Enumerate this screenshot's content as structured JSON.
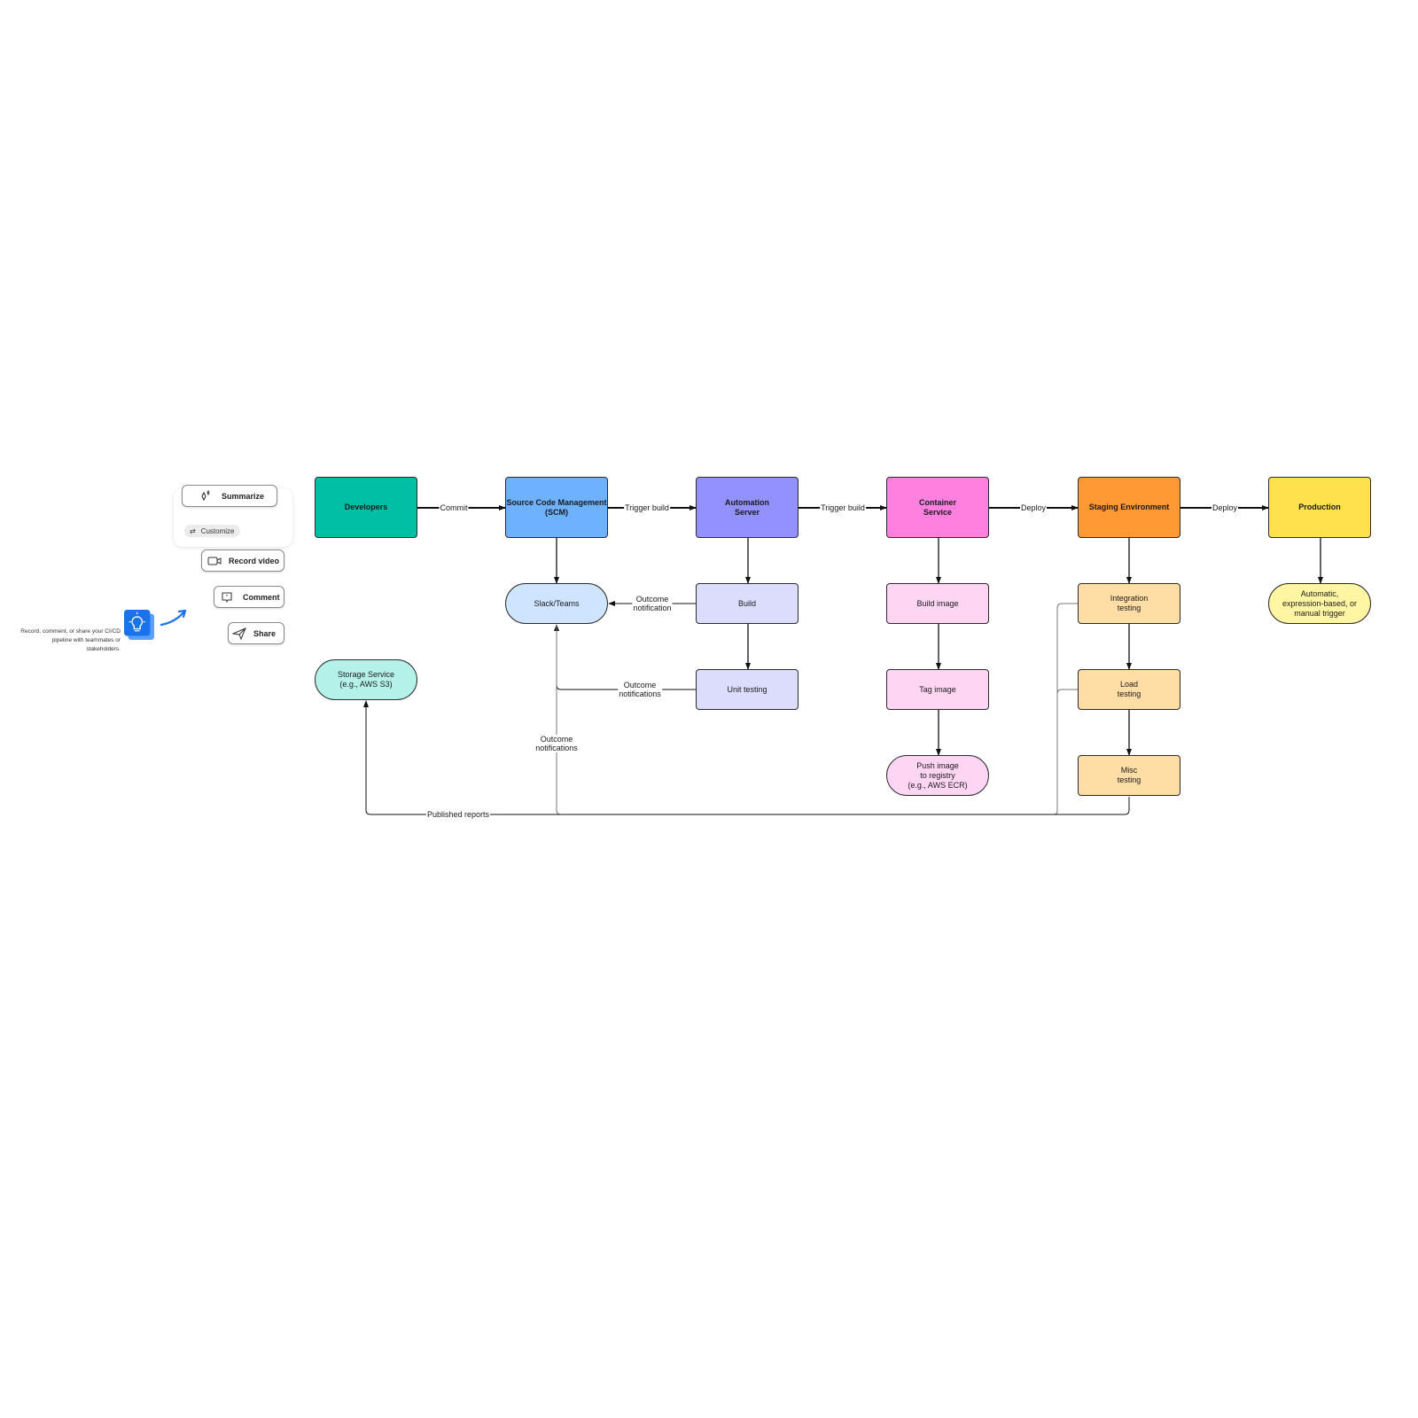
{
  "panel": {
    "summarize_label": "Summarize",
    "customize_label": "Customize",
    "record_video_label": "Record video",
    "comment_label": "Comment",
    "share_label": "Share",
    "hint_text": "Record, comment, or share your CI/CD pipeline with teammates or stakeholders.",
    "accent_color": "#1a73e8"
  },
  "nodes": {
    "developers": {
      "label": "Developers",
      "color": "#00bfa5"
    },
    "scm": {
      "label": "Source Code Management\n(SCM)",
      "color": "#6eb1ff"
    },
    "automation": {
      "label": "Automation\nServer",
      "color": "#9391ff"
    },
    "container": {
      "label": "Container\nService",
      "color": "#ff80df"
    },
    "staging": {
      "label": "Staging Environment",
      "color": "#ff9933"
    },
    "production": {
      "label": "Production",
      "color": "#ffe14d"
    },
    "slack": {
      "label": "Slack/Teams",
      "color": "#cfe4ff"
    },
    "build": {
      "label": "Build",
      "color": "#dcdcfd"
    },
    "unit": {
      "label": "Unit testing",
      "color": "#dcdcfd"
    },
    "storage": {
      "label": "Storage Service\n(e.g., AWS S3)",
      "color": "#b4f2e9"
    },
    "build_image": {
      "label": "Build image",
      "color": "#ffd5f4"
    },
    "tag_image": {
      "label": "Tag image",
      "color": "#ffd5f4"
    },
    "push_image": {
      "label": "Push image\nto registry\n(e.g., AWS ECR)",
      "color": "#ffd5f4"
    },
    "integration": {
      "label": "Integration\ntesting",
      "color": "#ffdea6"
    },
    "load": {
      "label": "Load\ntesting",
      "color": "#ffdea6"
    },
    "misc": {
      "label": "Misc\ntesting",
      "color": "#ffdea6"
    },
    "trigger": {
      "label": "Automatic,\nexpression-based, or\nmanual trigger",
      "color": "#fff5a3"
    }
  },
  "edges": {
    "commit": "Commit",
    "trigger_build_1": "Trigger build",
    "trigger_build_2": "Trigger build",
    "deploy_1": "Deploy",
    "deploy_2": "Deploy",
    "outcome_notification": "Outcome\nnotification",
    "outcome_notifications_unit": "Outcome\nnotifications",
    "outcome_notifications_tests": "Outcome\nnotifications",
    "published_reports": "Published reports"
  }
}
